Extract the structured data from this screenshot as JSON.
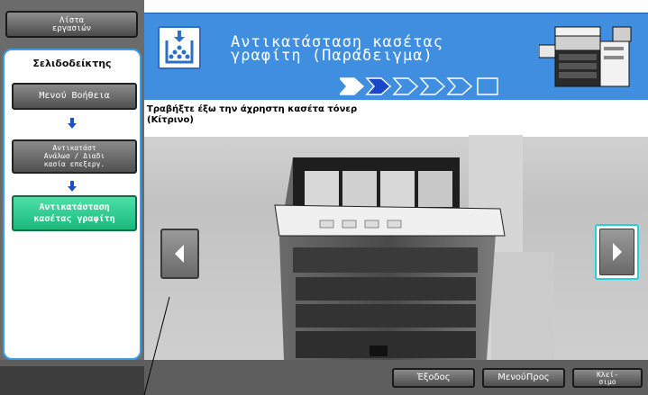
{
  "sidebar": {
    "job_list_label": "Λίστα\nεργασιών",
    "bookmarks_title": "Σελιδοδείκτης",
    "items": [
      {
        "label": "Μενού Βοήθεια"
      },
      {
        "label": "Αντικατάστ\nΑνάλωσ / Διαδι\nκασία επεξεργ."
      },
      {
        "label": "Αντικατάσταση\nκασέτας γραφίτη"
      }
    ]
  },
  "header": {
    "title": "Αντικατάσταση κασέτας\nγραφίτη (Παράδειγμα)",
    "steps_total": 6,
    "steps_current": 2
  },
  "content": {
    "instruction": "Τραβήξτε έξω την άχρηστη κασέτα τόνερ\n(Κίτρινο)"
  },
  "footer": {
    "exit_label": "Έξοδος",
    "menu_label": "ΜενούΠρος",
    "close_label": "Κλεί-\nσιμο"
  },
  "colors": {
    "accent": "#3f8ee0",
    "active_item": "#18b97c",
    "highlight": "#22d0e0"
  }
}
